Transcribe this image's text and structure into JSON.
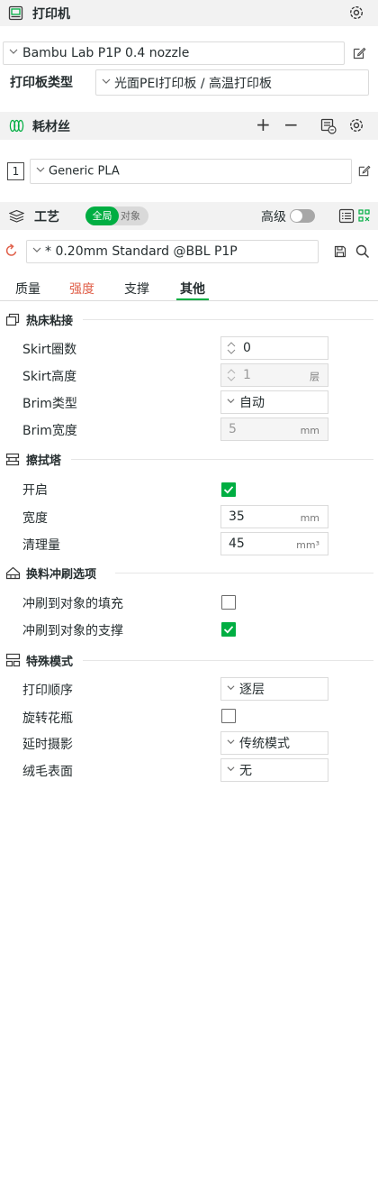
{
  "printer": {
    "title": "打印机",
    "preset": "Bambu Lab P1P 0.4 nozzle",
    "plate_label": "打印板类型",
    "plate_value": "光面PEI打印板 / 高温打印板"
  },
  "filament": {
    "title": "耗材丝",
    "add_label": "+",
    "remove_label": "−",
    "slot_number": "1",
    "preset": "Generic PLA"
  },
  "process": {
    "title": "工艺",
    "toggle_global": "全局",
    "toggle_object": "对象",
    "advanced_label": "高级",
    "preset": "* 0.20mm Standard @BBL P1P"
  },
  "tabs": [
    {
      "label": "质量"
    },
    {
      "label": "强度"
    },
    {
      "label": "支撑"
    },
    {
      "label": "其他"
    }
  ],
  "sections": {
    "bed_adhesion": {
      "title": "热床粘接",
      "skirt_loops_label": "Skirt圈数",
      "skirt_loops_value": "0",
      "skirt_height_label": "Skirt高度",
      "skirt_height_value": "1",
      "skirt_height_unit": "层",
      "brim_type_label": "Brim类型",
      "brim_type_value": "自动",
      "brim_width_label": "Brim宽度",
      "brim_width_value": "5",
      "brim_width_unit": "mm"
    },
    "prime_tower": {
      "title": "擦拭塔",
      "enable_label": "开启",
      "width_label": "宽度",
      "width_value": "35",
      "width_unit": "mm",
      "volume_label": "清理量",
      "volume_value": "45",
      "volume_unit": "mm³"
    },
    "flush": {
      "title": "换料冲刷选项",
      "infill_label": "冲刷到对象的填充",
      "support_label": "冲刷到对象的支撑"
    },
    "special": {
      "title": "特殊模式",
      "sequence_label": "打印顺序",
      "sequence_value": "逐层",
      "vase_label": "旋转花瓶",
      "timelapse_label": "延时摄影",
      "timelapse_value": "传统模式",
      "fuzzy_label": "绒毛表面",
      "fuzzy_value": "无"
    }
  },
  "colors": {
    "accent": "#00ae42",
    "active_tab": "#e0604a"
  }
}
